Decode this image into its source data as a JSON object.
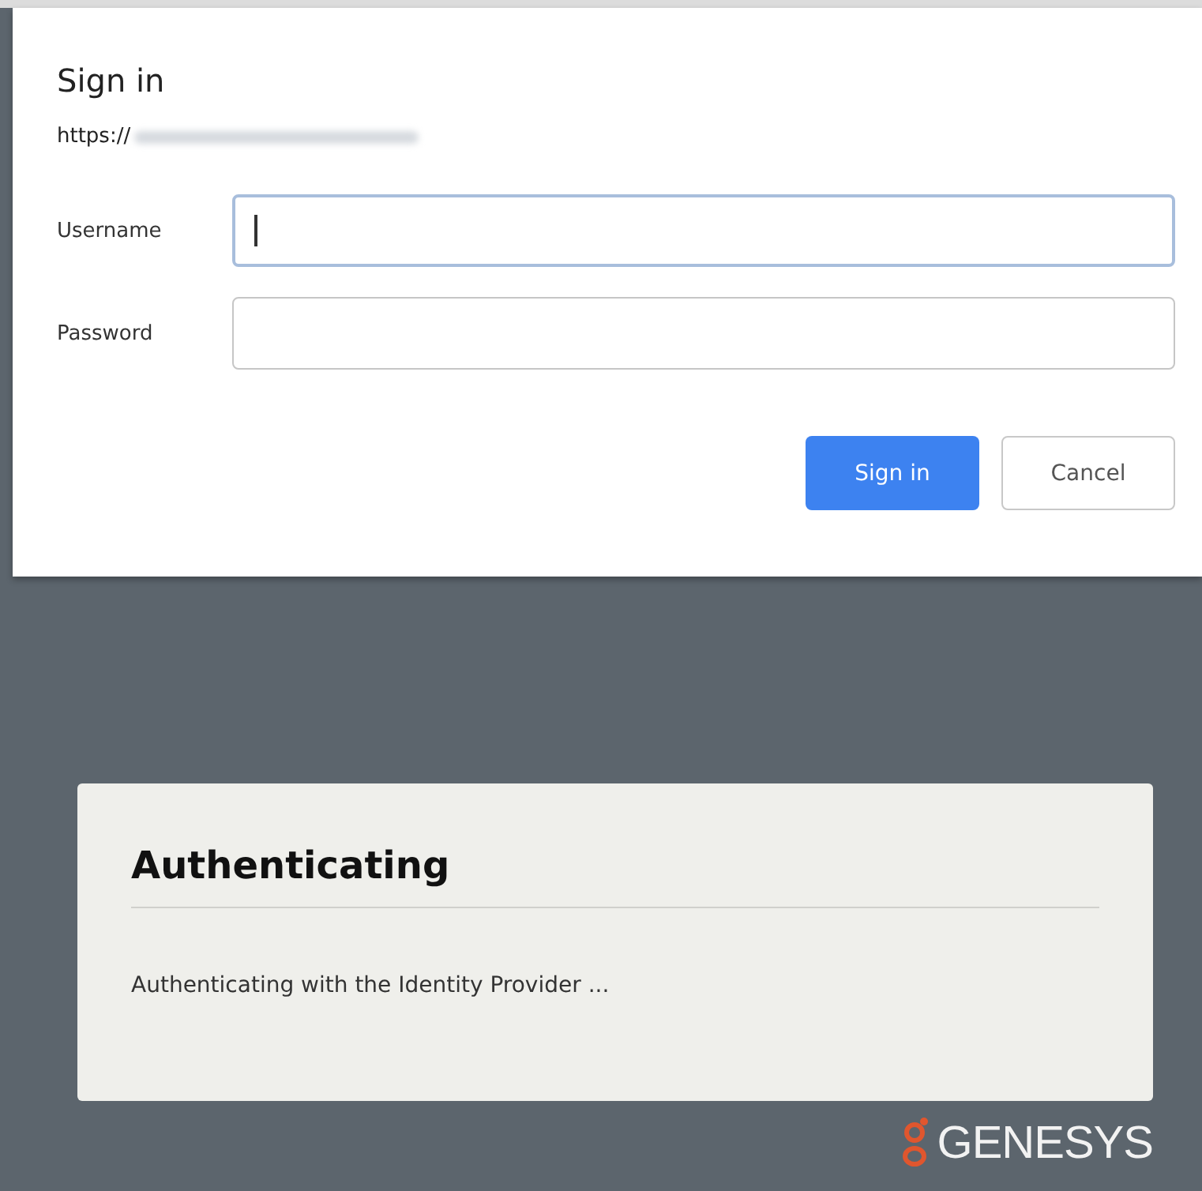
{
  "dialog": {
    "title": "Sign in",
    "url_prefix": "https://",
    "fields": [
      {
        "label": "Username",
        "focused": true
      },
      {
        "label": "Password",
        "focused": false
      }
    ],
    "buttons": [
      {
        "label": "Sign in",
        "kind": "primary"
      },
      {
        "label": "Cancel",
        "kind": "secondary"
      }
    ]
  },
  "card": {
    "title": "Authenticating",
    "message": "Authenticating with the Identity Provider ..."
  },
  "brand": {
    "name": "GENESYS"
  }
}
